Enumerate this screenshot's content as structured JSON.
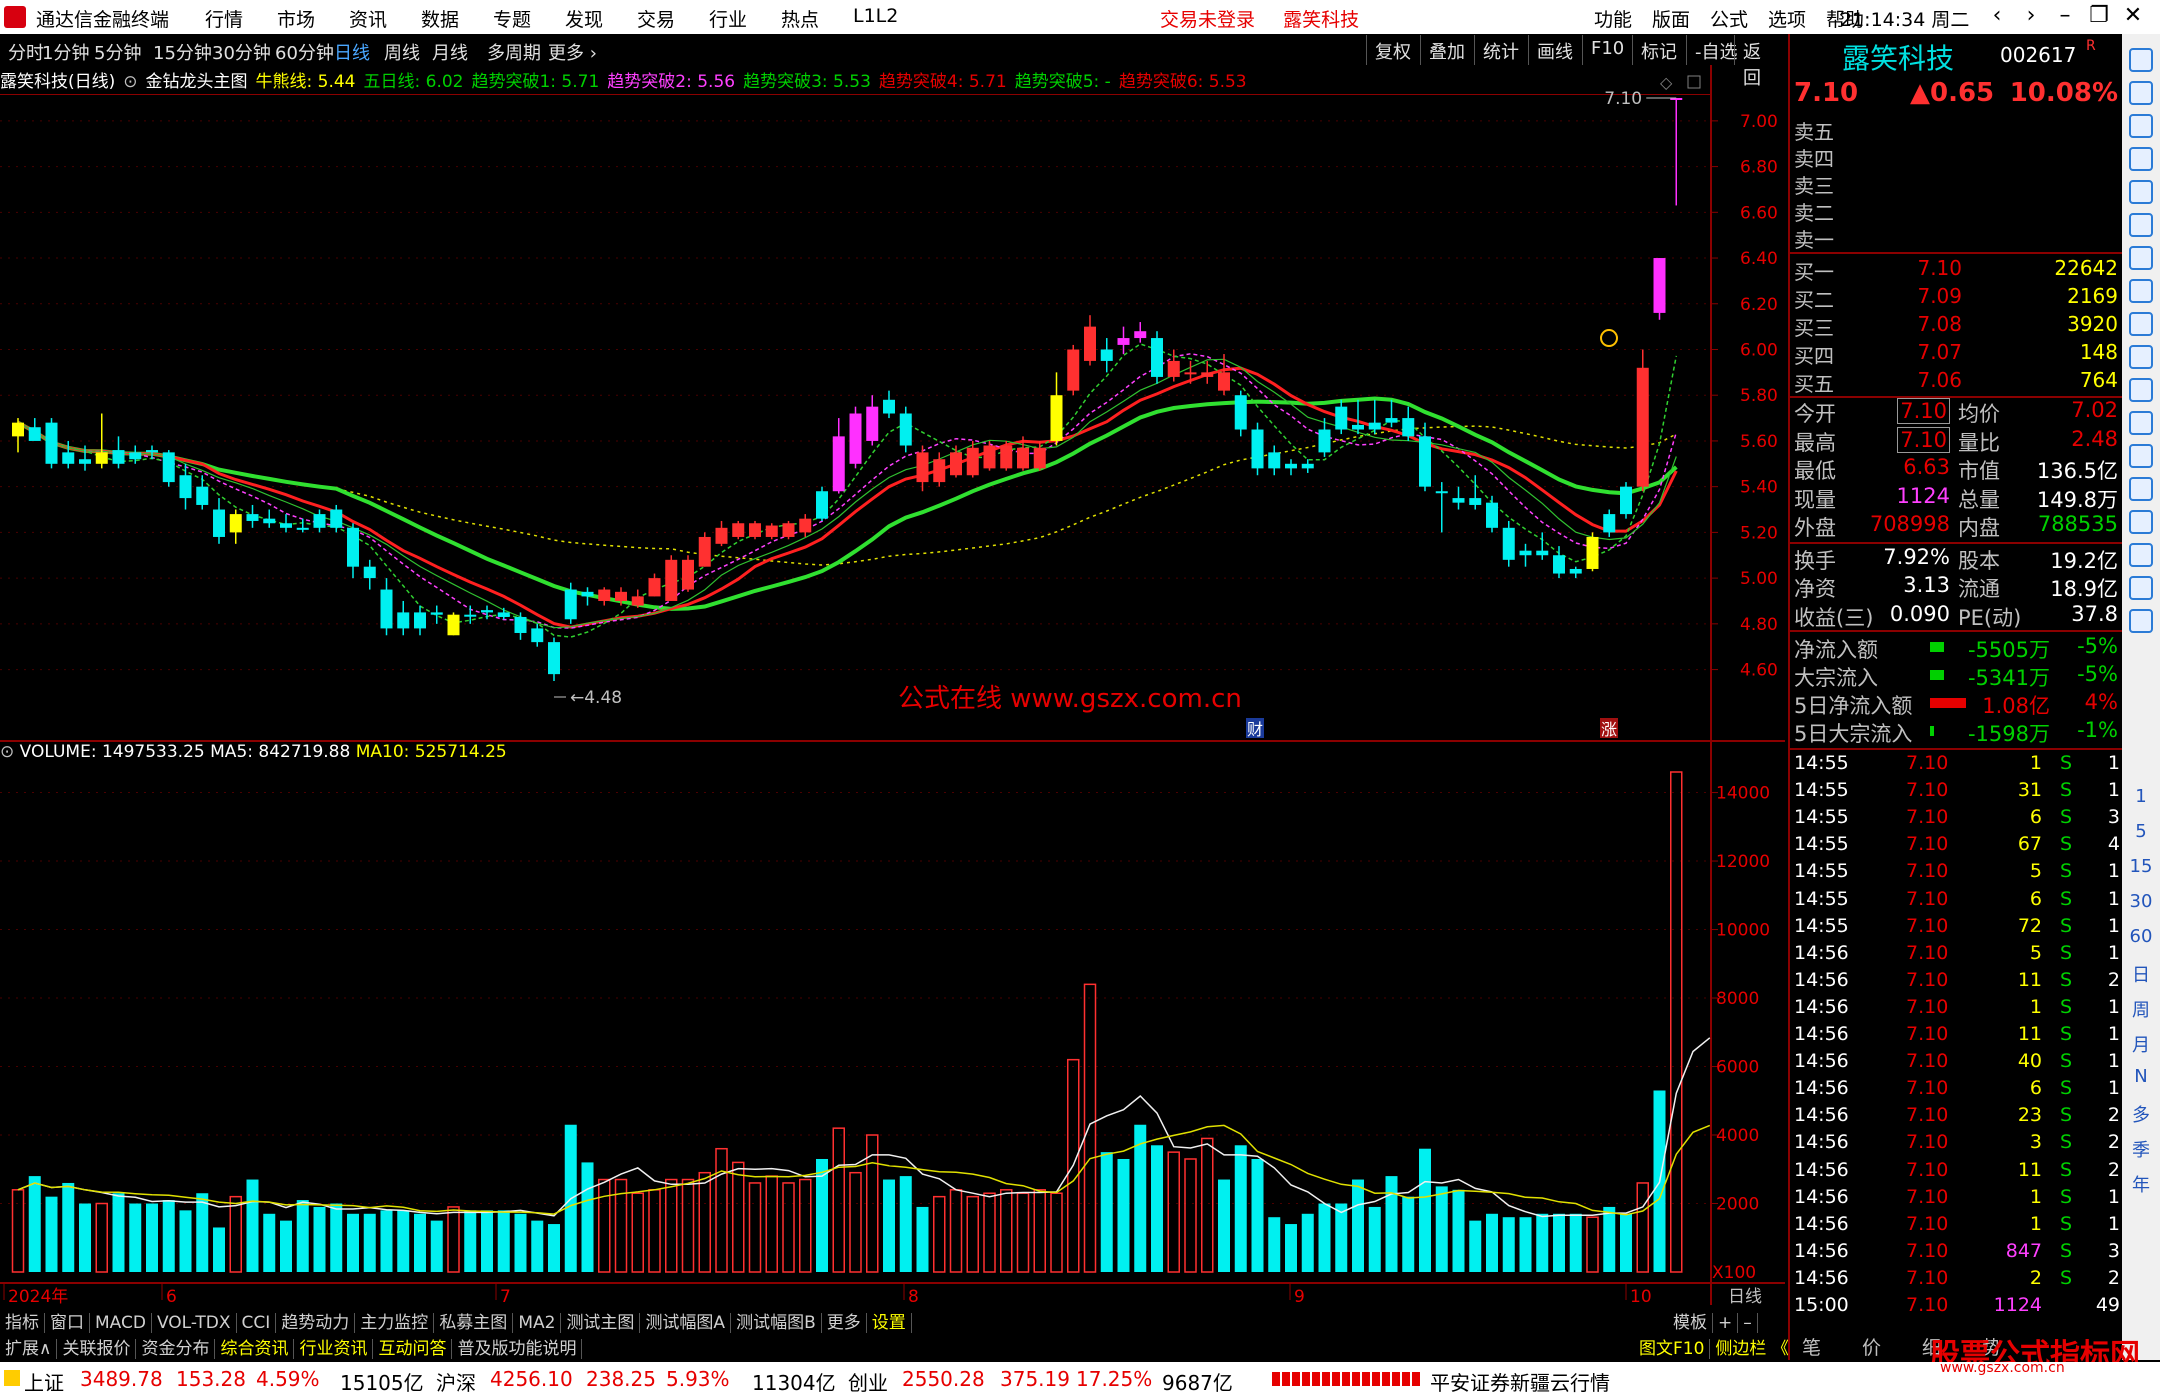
{
  "titlebar": {
    "app": "通达信金融终端",
    "menu": [
      "行情",
      "市场",
      "资讯",
      "数据",
      "专题",
      "发现",
      "交易",
      "行业",
      "热点",
      "L1L2"
    ],
    "status1": "交易未登录",
    "status2": "露笑科技",
    "rmenu": [
      "功能",
      "版面",
      "公式",
      "选项",
      "帮助"
    ],
    "time": "21:14:34",
    "day": "周二",
    "winctl": [
      "‹",
      "›",
      "–",
      "❐",
      "✕"
    ]
  },
  "periodtabs": [
    "分时",
    "1分钟",
    "5分钟",
    "15分钟",
    "30分钟",
    "60分钟",
    "日线",
    "周线",
    "月线",
    "多周期",
    "更多 ›"
  ],
  "active_period": "日线",
  "rightbtns": [
    "复权",
    "叠加",
    "统计",
    "画线",
    "F10",
    "标记",
    "-自选",
    "返回"
  ],
  "indicator_line": {
    "stock": "露笑科技(日线)",
    "formula": "金钻龙头主图",
    "items": [
      {
        "t": "牛熊线: 5.44",
        "c": "#ffff00"
      },
      {
        "t": "五日线: 6.02",
        "c": "#00d000"
      },
      {
        "t": "趋势突破1: 5.71",
        "c": "#00d000"
      },
      {
        "t": "趋势突破2: 5.56",
        "c": "#ff40ff"
      },
      {
        "t": "趋势突破3: 5.53",
        "c": "#00d000"
      },
      {
        "t": "趋势突破4: 5.71",
        "c": "#e60000"
      },
      {
        "t": "趋势突破5: -",
        "c": "#00d000"
      },
      {
        "t": "趋势突破6: 5.53",
        "c": "#e60000"
      }
    ]
  },
  "volume_line": {
    "label": "VOLUME: 1497533.25",
    "ma5": "MA5: 842719.88",
    "ma10": "MA10: 525714.25"
  },
  "price_axis": [
    "7.00",
    "6.80",
    "6.60",
    "6.40",
    "6.20",
    "6.00",
    "5.80",
    "5.60",
    "5.40",
    "5.20",
    "5.00",
    "4.80",
    "4.60"
  ],
  "volume_axis": [
    "14000",
    "12000",
    "10000",
    "8000",
    "6000",
    "4000",
    "2000"
  ],
  "volume_unit": "X100",
  "date_axis": [
    {
      "t": "2024年",
      "x": 8
    },
    {
      "t": "6",
      "x": 166
    },
    {
      "t": "7",
      "x": 500
    },
    {
      "t": "8",
      "x": 908
    },
    {
      "t": "9",
      "x": 1294
    },
    {
      "t": "10",
      "x": 1630
    }
  ],
  "date_axis_right": "日线",
  "max_label": "7.10",
  "min_label": "4.48",
  "watermark": "公式在线  www.gszx.com.cn",
  "markers": {
    "cai": "财",
    "zhang": "涨"
  },
  "bottom_tabs": [
    "指标",
    "窗口",
    "MACD",
    "VOL-TDX",
    "CCI",
    "趋势动力",
    "主力监控",
    "私募主图",
    "MA2",
    "测试主图",
    "测试幅图A",
    "测试幅图B",
    "更多",
    "设置"
  ],
  "bottom_right_tabs": [
    "模板",
    "+",
    "–"
  ],
  "lower_tabs": [
    "扩展∧",
    "关联报价",
    "资金分布",
    "综合资讯",
    "行业资讯",
    "互动问答",
    "普及版功能说明"
  ],
  "lower_right": [
    "图文F10",
    "侧边栏 《"
  ],
  "statusbar": {
    "sh_label": "上证",
    "sh": "3489.78",
    "sh_chg": "153.28",
    "sh_pct": "4.59%",
    "sh_amt": "15105亿",
    "hs_label": "沪深",
    "hs": "4256.10",
    "hs_chg": "238.25",
    "hs_pct": "5.93%",
    "hs_amt": "11304亿",
    "cy_label": "创业",
    "cy": "2550.28",
    "cy_chg": "375.19",
    "cy_pct": "17.25%",
    "cy_amt": "9687亿",
    "broker": "平安证券新疆云行情"
  },
  "quote": {
    "name": "露笑科技",
    "code": "002617",
    "r": "R",
    "price": "7.10",
    "chg": "▲0.65",
    "pct": "10.08%"
  },
  "sells": [
    "卖五",
    "卖四",
    "卖三",
    "卖二",
    "卖一"
  ],
  "buys": [
    {
      "k": "买一",
      "p": "7.10",
      "v": "22642"
    },
    {
      "k": "买二",
      "p": "7.09",
      "v": "2169"
    },
    {
      "k": "买三",
      "p": "7.08",
      "v": "3920"
    },
    {
      "k": "买四",
      "p": "7.07",
      "v": "148"
    },
    {
      "k": "买五",
      "p": "7.06",
      "v": "764"
    }
  ],
  "stats": [
    {
      "k1": "今开",
      "v1": "7.10",
      "c1": "#e60000",
      "b1": true,
      "k2": "均价",
      "v2": "7.02",
      "c2": "#e60000"
    },
    {
      "k1": "最高",
      "v1": "7.10",
      "c1": "#e60000",
      "b1": true,
      "k2": "量比",
      "v2": "2.48",
      "c2": "#e60000"
    },
    {
      "k1": "最低",
      "v1": "6.63",
      "c1": "#e60000",
      "k2": "市值",
      "v2": "136.5亿",
      "c2": "#fff"
    },
    {
      "k1": "现量",
      "v1": "1124",
      "c1": "#ff40ff",
      "k2": "总量",
      "v2": "149.8万",
      "c2": "#fff"
    },
    {
      "k1": "外盘",
      "v1": "708998",
      "c1": "#e60000",
      "k2": "内盘",
      "v2": "788535",
      "c2": "#00d000"
    },
    {
      "k1": "换手",
      "v1": "7.92%",
      "c1": "#fff",
      "k2": "股本",
      "v2": "19.2亿",
      "c2": "#fff"
    },
    {
      "k1": "净资",
      "v1": "3.13",
      "c1": "#fff",
      "k2": "流通",
      "v2": "18.9亿",
      "c2": "#fff"
    },
    {
      "k1": "收益(三)",
      "v1": "0.090",
      "c1": "#fff",
      "k2": "PE(动)",
      "v2": "37.8",
      "c2": "#fff"
    }
  ],
  "flows": [
    {
      "k": "净流入额",
      "v": "-5505万",
      "p": "-5%",
      "c": "#00d000",
      "w": 14
    },
    {
      "k": "大宗流入",
      "v": "-5341万",
      "p": "-5%",
      "c": "#00d000",
      "w": 14
    },
    {
      "k": "5日净流入额",
      "v": "1.08亿",
      "p": "4%",
      "c": "#e60000",
      "w": 36
    },
    {
      "k": "5日大宗流入",
      "v": "-1598万",
      "p": "-1%",
      "c": "#00d000",
      "w": 4
    }
  ],
  "ticks": [
    {
      "t": "14:55",
      "p": "7.10",
      "v": "1",
      "s": "S",
      "n": "1"
    },
    {
      "t": "14:55",
      "p": "7.10",
      "v": "31",
      "s": "S",
      "n": "1"
    },
    {
      "t": "14:55",
      "p": "7.10",
      "v": "6",
      "s": "S",
      "n": "3"
    },
    {
      "t": "14:55",
      "p": "7.10",
      "v": "67",
      "s": "S",
      "n": "4"
    },
    {
      "t": "14:55",
      "p": "7.10",
      "v": "5",
      "s": "S",
      "n": "1"
    },
    {
      "t": "14:55",
      "p": "7.10",
      "v": "6",
      "s": "S",
      "n": "1"
    },
    {
      "t": "14:55",
      "p": "7.10",
      "v": "72",
      "s": "S",
      "n": "1"
    },
    {
      "t": "14:56",
      "p": "7.10",
      "v": "5",
      "s": "S",
      "n": "1"
    },
    {
      "t": "14:56",
      "p": "7.10",
      "v": "11",
      "s": "S",
      "n": "2"
    },
    {
      "t": "14:56",
      "p": "7.10",
      "v": "1",
      "s": "S",
      "n": "1"
    },
    {
      "t": "14:56",
      "p": "7.10",
      "v": "11",
      "s": "S",
      "n": "1"
    },
    {
      "t": "14:56",
      "p": "7.10",
      "v": "40",
      "s": "S",
      "n": "1"
    },
    {
      "t": "14:56",
      "p": "7.10",
      "v": "6",
      "s": "S",
      "n": "1"
    },
    {
      "t": "14:56",
      "p": "7.10",
      "v": "23",
      "s": "S",
      "n": "2"
    },
    {
      "t": "14:56",
      "p": "7.10",
      "v": "3",
      "s": "S",
      "n": "2"
    },
    {
      "t": "14:56",
      "p": "7.10",
      "v": "11",
      "s": "S",
      "n": "2"
    },
    {
      "t": "14:56",
      "p": "7.10",
      "v": "1",
      "s": "S",
      "n": "1"
    },
    {
      "t": "14:56",
      "p": "7.10",
      "v": "1",
      "s": "S",
      "n": "1"
    },
    {
      "t": "14:56",
      "p": "7.10",
      "v": "847",
      "s": "S",
      "n": "3",
      "vc": "#ff40ff"
    },
    {
      "t": "14:56",
      "p": "7.10",
      "v": "2",
      "s": "S",
      "n": "2"
    },
    {
      "t": "15:00",
      "p": "7.10",
      "v": "1124",
      "s": "",
      "n": "49",
      "vc": "#ff40ff"
    }
  ],
  "rp_tabs": [
    "笔",
    "价",
    "细",
    "势"
  ],
  "side_text": [
    "1",
    "5",
    "15",
    "30",
    "60",
    "日",
    "周",
    "月",
    "N",
    "多",
    "季",
    "年"
  ],
  "logo": {
    "main": "股票公式指标网",
    "sub": "www.gszx.com.cn"
  },
  "chart_data": {
    "type": "candlestick",
    "ylim": [
      4.48,
      7.1
    ],
    "candles": [
      [
        5.62,
        5.7,
        5.55,
        5.68,
        "y"
      ],
      [
        5.66,
        5.7,
        5.62,
        5.6,
        "c"
      ],
      [
        5.68,
        5.7,
        5.48,
        5.5,
        "c"
      ],
      [
        5.55,
        5.6,
        5.48,
        5.5,
        "c"
      ],
      [
        5.52,
        5.58,
        5.47,
        5.5,
        "c"
      ],
      [
        5.5,
        5.72,
        5.48,
        5.55,
        "y"
      ],
      [
        5.56,
        5.62,
        5.48,
        5.5,
        "c"
      ],
      [
        5.55,
        5.58,
        5.5,
        5.52,
        "c"
      ],
      [
        5.56,
        5.58,
        5.52,
        5.55,
        "c"
      ],
      [
        5.55,
        5.56,
        5.4,
        5.42,
        "c"
      ],
      [
        5.45,
        5.5,
        5.3,
        5.35,
        "c"
      ],
      [
        5.4,
        5.45,
        5.3,
        5.32,
        "c"
      ],
      [
        5.3,
        5.35,
        5.15,
        5.18,
        "c"
      ],
      [
        5.2,
        5.3,
        5.15,
        5.28,
        "y"
      ],
      [
        5.28,
        5.32,
        5.22,
        5.25,
        "c"
      ],
      [
        5.26,
        5.3,
        5.22,
        5.24,
        "c"
      ],
      [
        5.24,
        5.28,
        5.2,
        5.22,
        "c"
      ],
      [
        5.22,
        5.26,
        5.2,
        5.22,
        "c"
      ],
      [
        5.28,
        5.3,
        5.2,
        5.22,
        "c"
      ],
      [
        5.3,
        5.32,
        5.2,
        5.22,
        "c"
      ],
      [
        5.22,
        5.24,
        5.0,
        5.05,
        "c"
      ],
      [
        5.05,
        5.08,
        4.95,
        5.0,
        "c"
      ],
      [
        4.95,
        5.0,
        4.75,
        4.78,
        "c"
      ],
      [
        4.85,
        4.9,
        4.75,
        4.78,
        "c"
      ],
      [
        4.85,
        4.88,
        4.75,
        4.78,
        "c"
      ],
      [
        4.85,
        4.88,
        4.8,
        4.84,
        "c"
      ],
      [
        4.75,
        4.85,
        4.75,
        4.84,
        "y"
      ],
      [
        4.84,
        4.88,
        4.8,
        4.84,
        "c"
      ],
      [
        4.85,
        4.88,
        4.82,
        4.86,
        "c"
      ],
      [
        4.85,
        4.87,
        4.82,
        4.83,
        "c"
      ],
      [
        4.83,
        4.85,
        4.73,
        4.76,
        "c"
      ],
      [
        4.78,
        4.8,
        4.7,
        4.72,
        "c"
      ],
      [
        4.72,
        4.74,
        4.55,
        4.58,
        "c"
      ],
      [
        4.95,
        4.98,
        4.8,
        4.82,
        "c"
      ],
      [
        4.92,
        4.96,
        4.88,
        4.94,
        "c"
      ],
      [
        4.9,
        4.96,
        4.88,
        4.95,
        "r"
      ],
      [
        4.9,
        4.96,
        4.88,
        4.94,
        "r"
      ],
      [
        4.88,
        4.95,
        4.87,
        4.92,
        "r"
      ],
      [
        4.92,
        5.02,
        4.92,
        5.0,
        "r"
      ],
      [
        4.9,
        5.1,
        4.9,
        5.08,
        "r"
      ],
      [
        4.95,
        5.1,
        4.94,
        5.08,
        "r"
      ],
      [
        5.05,
        5.2,
        5.05,
        5.18,
        "r"
      ],
      [
        5.15,
        5.25,
        5.14,
        5.22,
        "r"
      ],
      [
        5.18,
        5.25,
        5.17,
        5.24,
        "r"
      ],
      [
        5.18,
        5.25,
        5.17,
        5.24,
        "r"
      ],
      [
        5.18,
        5.24,
        5.17,
        5.23,
        "r"
      ],
      [
        5.18,
        5.25,
        5.17,
        5.24,
        "r"
      ],
      [
        5.2,
        5.28,
        5.18,
        5.26,
        "r"
      ],
      [
        5.26,
        5.4,
        5.25,
        5.38,
        "c"
      ],
      [
        5.38,
        5.7,
        5.37,
        5.62,
        "m"
      ],
      [
        5.5,
        5.75,
        5.48,
        5.72,
        "m"
      ],
      [
        5.6,
        5.8,
        5.58,
        5.75,
        "m"
      ],
      [
        5.78,
        5.82,
        5.7,
        5.72,
        "c"
      ],
      [
        5.72,
        5.75,
        5.55,
        5.58,
        "c"
      ],
      [
        5.55,
        5.58,
        5.38,
        5.42,
        "r"
      ],
      [
        5.42,
        5.55,
        5.4,
        5.52,
        "r"
      ],
      [
        5.45,
        5.58,
        5.44,
        5.55,
        "r"
      ],
      [
        5.45,
        5.6,
        5.44,
        5.57,
        "r"
      ],
      [
        5.48,
        5.6,
        5.47,
        5.58,
        "r"
      ],
      [
        5.48,
        5.6,
        5.47,
        5.58,
        "r"
      ],
      [
        5.48,
        5.62,
        5.47,
        5.57,
        "r"
      ],
      [
        5.48,
        5.6,
        5.47,
        5.57,
        "r"
      ],
      [
        5.6,
        5.9,
        5.58,
        5.8,
        "y"
      ],
      [
        5.82,
        6.02,
        5.8,
        6.0,
        "r"
      ],
      [
        5.95,
        6.15,
        5.93,
        6.1,
        "r"
      ],
      [
        6.0,
        6.05,
        5.9,
        5.95,
        "c"
      ],
      [
        6.05,
        6.1,
        5.98,
        6.02,
        "m"
      ],
      [
        6.08,
        6.12,
        6.03,
        6.05,
        "m"
      ],
      [
        6.05,
        6.08,
        5.85,
        5.88,
        "c"
      ],
      [
        5.88,
        6.0,
        5.86,
        5.95,
        "r"
      ],
      [
        5.9,
        5.95,
        5.85,
        5.9,
        "r"
      ],
      [
        5.88,
        5.95,
        5.85,
        5.9,
        "r"
      ],
      [
        5.9,
        5.98,
        5.8,
        5.82,
        "r"
      ],
      [
        5.8,
        5.82,
        5.62,
        5.65,
        "c"
      ],
      [
        5.65,
        5.68,
        5.45,
        5.48,
        "c"
      ],
      [
        5.55,
        5.58,
        5.45,
        5.48,
        "c"
      ],
      [
        5.48,
        5.52,
        5.45,
        5.5,
        "c"
      ],
      [
        5.5,
        5.52,
        5.46,
        5.48,
        "c"
      ],
      [
        5.55,
        5.7,
        5.53,
        5.65,
        "c"
      ],
      [
        5.65,
        5.78,
        5.63,
        5.75,
        "c"
      ],
      [
        5.65,
        5.78,
        5.63,
        5.67,
        "c"
      ],
      [
        5.65,
        5.78,
        5.63,
        5.68,
        "c"
      ],
      [
        5.68,
        5.78,
        5.66,
        5.7,
        "c"
      ],
      [
        5.7,
        5.75,
        5.6,
        5.62,
        "c"
      ],
      [
        5.62,
        5.68,
        5.38,
        5.4,
        "c"
      ],
      [
        5.38,
        5.42,
        5.2,
        5.38,
        "c"
      ],
      [
        5.35,
        5.4,
        5.3,
        5.33,
        "c"
      ],
      [
        5.35,
        5.45,
        5.3,
        5.32,
        "c"
      ],
      [
        5.33,
        5.36,
        5.2,
        5.22,
        "c"
      ],
      [
        5.22,
        5.25,
        5.05,
        5.08,
        "c"
      ],
      [
        5.1,
        5.15,
        5.05,
        5.12,
        "c"
      ],
      [
        5.12,
        5.2,
        5.08,
        5.1,
        "c"
      ],
      [
        5.1,
        5.14,
        5.0,
        5.02,
        "c"
      ],
      [
        5.02,
        5.05,
        5.0,
        5.04,
        "c"
      ],
      [
        5.04,
        5.2,
        5.03,
        5.18,
        "y"
      ],
      [
        5.2,
        5.3,
        5.18,
        5.28,
        "c"
      ],
      [
        5.28,
        5.42,
        5.26,
        5.4,
        "c"
      ],
      [
        5.4,
        6.0,
        5.38,
        5.92,
        "r"
      ],
      [
        6.4,
        6.4,
        6.13,
        6.16,
        "m"
      ],
      [
        7.1,
        7.1,
        6.63,
        7.1,
        "m"
      ]
    ],
    "volume": [
      2400,
      2800,
      2200,
      2600,
      2000,
      2000,
      2300,
      2000,
      2000,
      2100,
      1800,
      2300,
      1300,
      2200,
      2700,
      1700,
      1500,
      2100,
      1900,
      2000,
      1700,
      1700,
      1800,
      1800,
      1700,
      1500,
      1900,
      1800,
      1800,
      1800,
      1700,
      1500,
      1400,
      4300,
      3200,
      2700,
      2700,
      2300,
      2400,
      2700,
      2700,
      2900,
      3600,
      3200,
      2600,
      2800,
      2600,
      2700,
      3300,
      4200,
      2900,
      4000,
      2700,
      2800,
      1900,
      2200,
      2400,
      2200,
      2300,
      2400,
      2300,
      2400,
      2300,
      6200,
      8400,
      3500,
      3300,
      4300,
      3700,
      3500,
      3300,
      3900,
      2700,
      3700,
      3300,
      1600,
      1400,
      1700,
      2000,
      2000,
      2700,
      1900,
      2800,
      2200,
      3600,
      2500,
      2400,
      1500,
      1700,
      1600,
      1600,
      1700,
      1700,
      1700,
      1600,
      1900,
      1700,
      2600,
      5300,
      14600,
      8000,
      3700
    ]
  }
}
